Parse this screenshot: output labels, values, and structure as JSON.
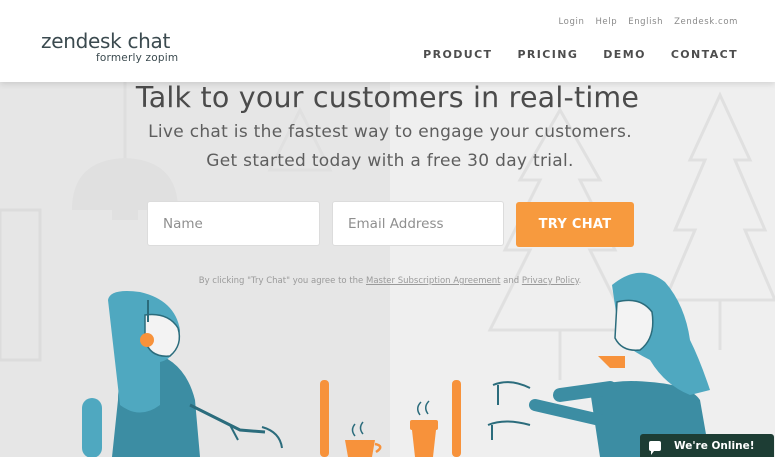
{
  "header": {
    "logo_main": "zendesk chat",
    "logo_sub": "formerly zopim",
    "util_links": [
      "Login",
      "Help",
      "English",
      "Zendesk.com"
    ],
    "nav": [
      "PRODUCT",
      "PRICING",
      "DEMO",
      "CONTACT"
    ]
  },
  "hero": {
    "headline": "Talk to your customers in real-time",
    "sub1": "Live chat is the fastest way to engage your customers.",
    "sub2": "Get started today with a free 30 day trial."
  },
  "form": {
    "name_placeholder": "Name",
    "email_placeholder": "Email Address",
    "submit_label": "TRY CHAT"
  },
  "disclaimer": {
    "prefix": "By clicking \"Try Chat\" you agree to the",
    "msa_link": "Master Subscription Agreement",
    "middle": "and",
    "privacy_link": "Privacy Policy",
    "suffix": "."
  },
  "chat_widget": {
    "label": "We're Online!",
    "icon": "speech-bubble-icon"
  },
  "colors": {
    "accent": "#f79a3e",
    "teal": "#4fa8c0",
    "dark_teal": "#2b6c7c",
    "widget": "#1d3d34"
  }
}
